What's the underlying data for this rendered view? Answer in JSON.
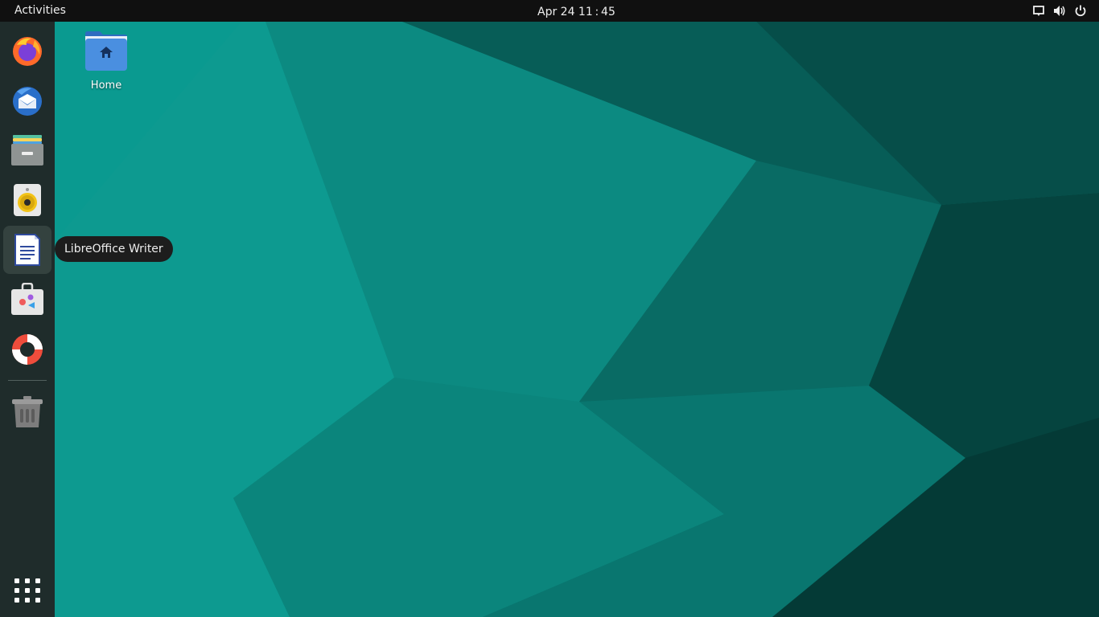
{
  "topbar": {
    "activities_label": "Activities",
    "clock": "Apr 24  11 : 45",
    "tray_icons": [
      "screen-icon",
      "volume-icon",
      "power-icon"
    ]
  },
  "dock": {
    "items": [
      {
        "name": "Firefox",
        "icon": "firefox-icon"
      },
      {
        "name": "Thunderbird",
        "icon": "thunderbird-icon"
      },
      {
        "name": "Files",
        "icon": "files-icon"
      },
      {
        "name": "Rhythmbox",
        "icon": "rhythmbox-icon"
      },
      {
        "name": "LibreOffice Writer",
        "icon": "writer-icon",
        "active": true
      },
      {
        "name": "Software",
        "icon": "software-icon"
      },
      {
        "name": "Help",
        "icon": "help-icon"
      },
      {
        "name": "Trash",
        "icon": "trash-icon"
      }
    ],
    "show_apps_icon": "app-grid-icon"
  },
  "tooltip": {
    "text": "LibreOffice Writer"
  },
  "desktop": {
    "icons": [
      {
        "label": "Home",
        "icon": "home-folder-icon"
      }
    ]
  },
  "colors": {
    "topbar": "#101010",
    "dock": "#1f2c2b",
    "wallpaper_light": "#0a9e94",
    "wallpaper_dark": "#063f3b"
  }
}
